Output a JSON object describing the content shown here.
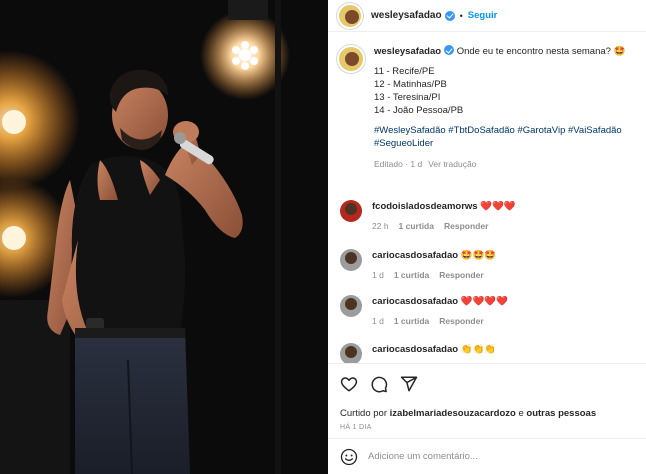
{
  "header": {
    "username": "wesleysafadao",
    "separator": "•",
    "follow_label": "Seguir"
  },
  "caption": {
    "username": "wesleysafadao",
    "intro": "Onde eu te encontro nesta semana? 🤩",
    "schedule": [
      "11 - Recife/PE",
      "12 - Matinhas/PB",
      "13 - Teresina/PI",
      "14 - João Pessoa/PB"
    ],
    "hashtags_line1": "#WesleySafadão #TbtDoSafadão #GarotaVip #VaiSafadão",
    "hashtags_line2": "#SegueoLider",
    "edited": "Editado · 1 d",
    "translate": "Ver tradução"
  },
  "comments": [
    {
      "username": "fcodoisladosdeamorws",
      "text": "❤️❤️❤️",
      "time": "22 h",
      "likes": "1 curtida",
      "reply": "Responder"
    },
    {
      "username": "cariocasdosafadao",
      "text": "🤩🤩🤩",
      "time": "1 d",
      "likes": "1 curtida",
      "reply": "Responder"
    },
    {
      "username": "cariocasdosafadao",
      "text": "❤️❤️❤️❤️",
      "time": "1 d",
      "likes": "1 curtida",
      "reply": "Responder"
    },
    {
      "username": "cariocasdosafadao",
      "text": "👏👏👏",
      "time": "",
      "likes": "",
      "reply": ""
    }
  ],
  "likes": {
    "prefix": "Curtido por",
    "user": "izabelmariadesouzacardozo",
    "middle": "e",
    "others": "outras pessoas"
  },
  "post_date": "HÁ 1 DIA",
  "comment_box": {
    "placeholder": "Adicione um comentário..."
  },
  "icons": {
    "like": "heart-icon",
    "comment": "comment-icon",
    "share": "share-icon",
    "emoji": "emoji-icon"
  },
  "colors": {
    "link": "#0095f6",
    "hashtag": "#00376b",
    "muted": "#8e8e8e"
  }
}
